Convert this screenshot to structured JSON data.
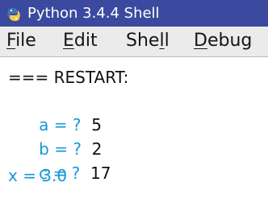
{
  "window": {
    "title": "Python 3.4.4 Shell",
    "icon": "python-icon"
  },
  "menu": {
    "items": [
      {
        "label": "File",
        "mnemonic": "F",
        "rest": "ile"
      },
      {
        "label": "Edit",
        "mnemonic": "E",
        "rest": "dit"
      },
      {
        "label": "Shell",
        "before": "She",
        "mnemonic": "l",
        "rest": "l"
      },
      {
        "label": "Debug",
        "mnemonic": "D",
        "rest": "ebug"
      }
    ]
  },
  "shell": {
    "lines": [
      {
        "text": "=== RESTART:"
      },
      {
        "prompt": "a = ?",
        "value": "5"
      },
      {
        "prompt": "b = ?",
        "value": "2"
      },
      {
        "prompt": "c = ?",
        "value": "17"
      },
      {
        "prompt": "x = 3.0",
        "value": ""
      }
    ]
  },
  "colors": {
    "titlebar": "#3b4a9e",
    "prompt_text": "#1698d9",
    "normal_text": "#111111"
  }
}
